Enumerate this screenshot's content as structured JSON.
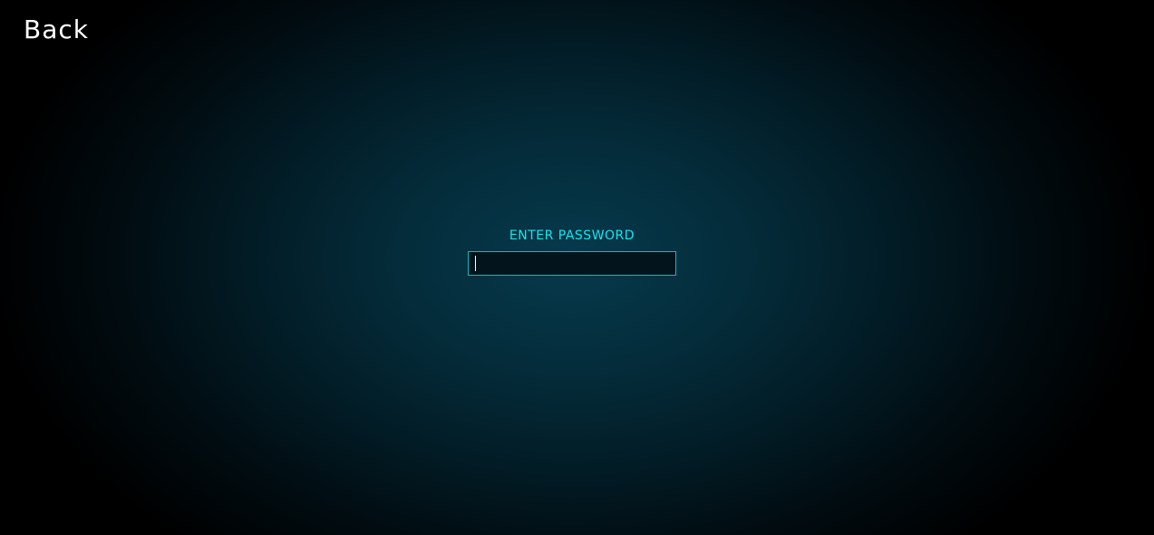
{
  "nav": {
    "back_label": "Back"
  },
  "login": {
    "label": "ENTER PASSWORD",
    "password_value": "",
    "placeholder": ""
  },
  "colors": {
    "accent": "#19e3f0",
    "input_border": "#15b8c4",
    "background_center": "#063a4d",
    "background_edge": "#000000",
    "text": "#ffffff"
  }
}
